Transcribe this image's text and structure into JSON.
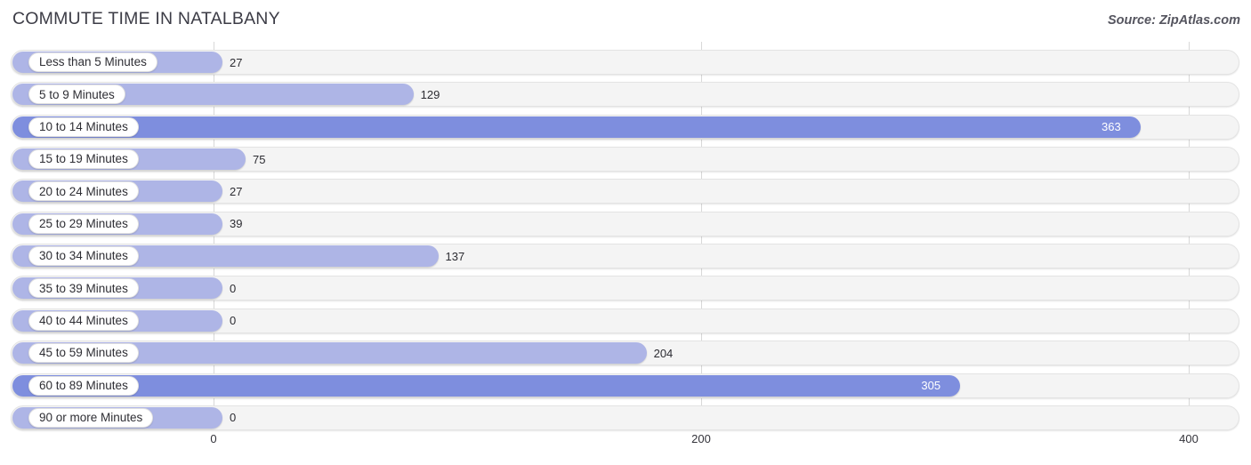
{
  "header": {
    "title": "COMMUTE TIME IN NATALBANY",
    "source": "Source: ZipAtlas.com"
  },
  "colors": {
    "bar_light": "#aeb5e6",
    "bar_dark": "#7e8ede",
    "track": "#f4f4f4",
    "gridline": "#d8d8d8",
    "title_text": "#3c3c46",
    "value_text": "#2c2c32",
    "value_text_inside": "#ffffff"
  },
  "chart_data": {
    "type": "bar",
    "orientation": "horizontal",
    "title": "COMMUTE TIME IN NATALBANY",
    "subtitle": "",
    "xlabel": "",
    "ylabel": "",
    "xlim": [
      0,
      400
    ],
    "grid": true,
    "legend": false,
    "categories": [
      "Less than 5 Minutes",
      "5 to 9 Minutes",
      "10 to 14 Minutes",
      "15 to 19 Minutes",
      "20 to 24 Minutes",
      "25 to 29 Minutes",
      "30 to 34 Minutes",
      "35 to 39 Minutes",
      "40 to 44 Minutes",
      "45 to 59 Minutes",
      "60 to 89 Minutes",
      "90 or more Minutes"
    ],
    "values": [
      27,
      129,
      363,
      75,
      27,
      39,
      137,
      0,
      0,
      204,
      305,
      0
    ],
    "value_labels": [
      "27",
      "129",
      "363",
      "75",
      "27",
      "39",
      "137",
      "0",
      "0",
      "204",
      "305",
      "0"
    ],
    "xticks": [
      0,
      200,
      400
    ],
    "xtick_labels": [
      "0",
      "200",
      "400"
    ]
  },
  "rows": [
    {
      "label": "Less than 5 Minutes",
      "value": 27,
      "value_label": "27",
      "shade": "light",
      "inside": false
    },
    {
      "label": "5 to 9 Minutes",
      "value": 129,
      "value_label": "129",
      "shade": "light",
      "inside": false
    },
    {
      "label": "10 to 14 Minutes",
      "value": 363,
      "value_label": "363",
      "shade": "dark",
      "inside": true
    },
    {
      "label": "15 to 19 Minutes",
      "value": 75,
      "value_label": "75",
      "shade": "light",
      "inside": false
    },
    {
      "label": "20 to 24 Minutes",
      "value": 27,
      "value_label": "27",
      "shade": "light",
      "inside": false
    },
    {
      "label": "25 to 29 Minutes",
      "value": 39,
      "value_label": "39",
      "shade": "light",
      "inside": false
    },
    {
      "label": "30 to 34 Minutes",
      "value": 137,
      "value_label": "137",
      "shade": "light",
      "inside": false
    },
    {
      "label": "35 to 39 Minutes",
      "value": 0,
      "value_label": "0",
      "shade": "light",
      "inside": false
    },
    {
      "label": "40 to 44 Minutes",
      "value": 0,
      "value_label": "0",
      "shade": "light",
      "inside": false
    },
    {
      "label": "45 to 59 Minutes",
      "value": 204,
      "value_label": "204",
      "shade": "light",
      "inside": false
    },
    {
      "label": "60 to 89 Minutes",
      "value": 305,
      "value_label": "305",
      "shade": "dark",
      "inside": true
    },
    {
      "label": "90 or more Minutes",
      "value": 0,
      "value_label": "0",
      "shade": "light",
      "inside": false
    }
  ],
  "axis": {
    "ticks": [
      {
        "label": "0",
        "value": 0
      },
      {
        "label": "200",
        "value": 200
      },
      {
        "label": "400",
        "value": 400
      }
    ]
  }
}
